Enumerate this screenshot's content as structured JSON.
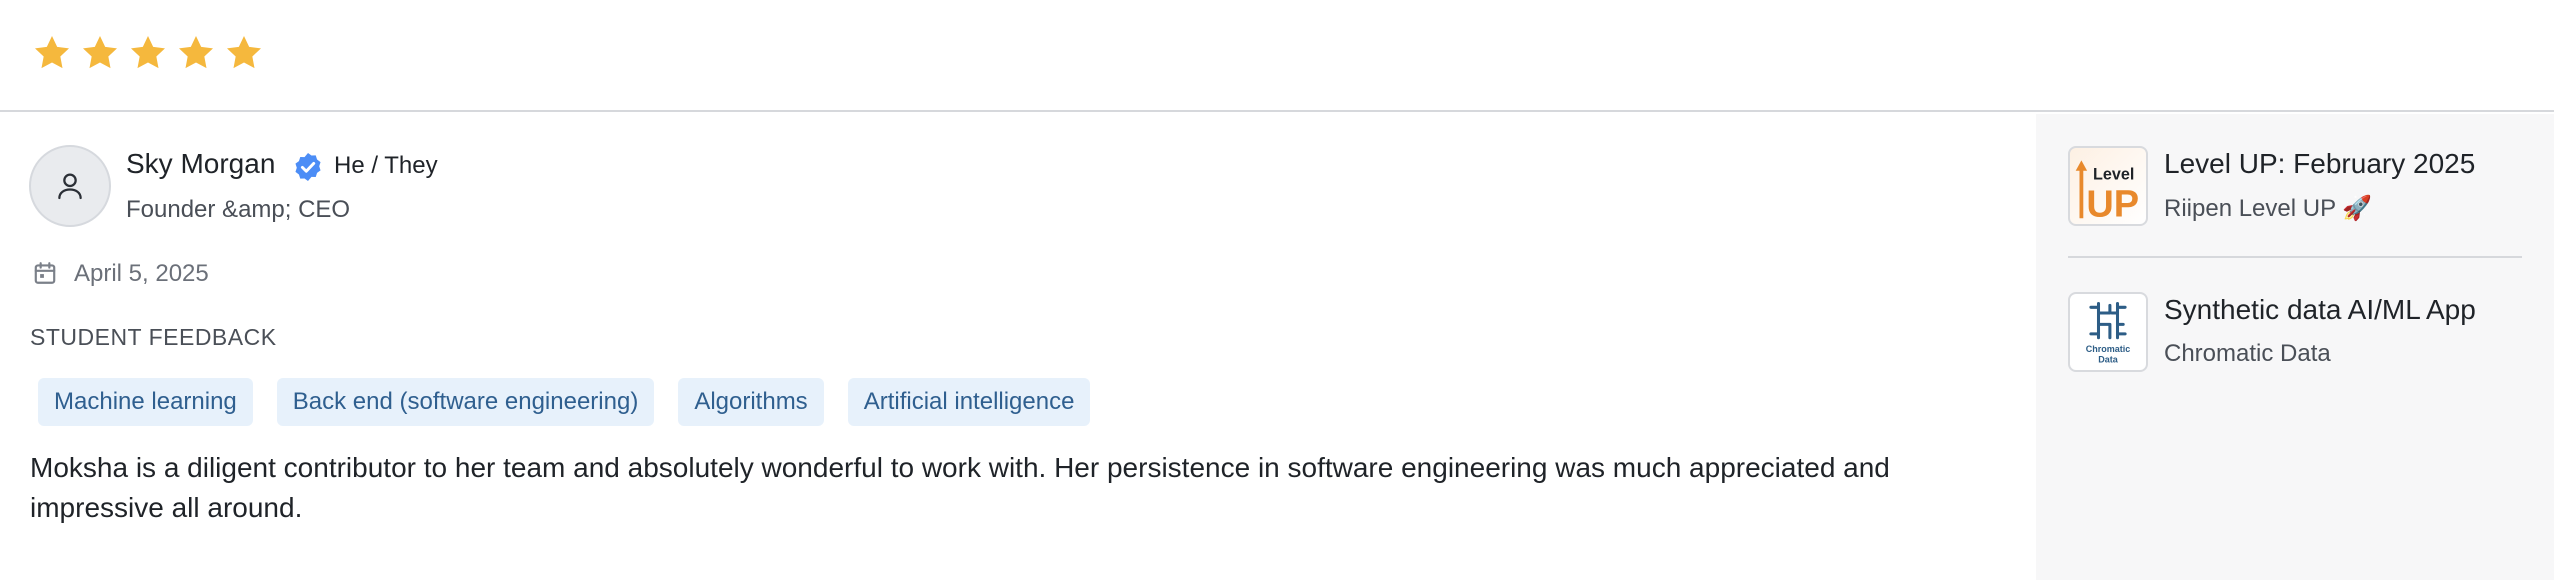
{
  "rating": {
    "value": 5,
    "max": 5,
    "color": "#f5b83d"
  },
  "reviewer": {
    "name": "Sky Morgan",
    "pronouns": "He / They",
    "role": "Founder &amp; CEO",
    "verified_color": "#4c8df6"
  },
  "date": "April 5, 2025",
  "section_label": "STUDENT FEEDBACK",
  "tags": [
    "Machine learning",
    "Back end (software engineering)",
    "Algorithms",
    "Artificial intelligence"
  ],
  "feedback": "Moksha is a diligent contributor to her team and absolutely wonderful to work with. Her persistence in software engineering was much appreciated and impressive all around.",
  "projects": [
    {
      "title": "Level UP: February 2025",
      "org": "Riipen Level UP 🚀",
      "logo_text": [
        "Level",
        "UP"
      ]
    },
    {
      "title": "Synthetic data AI/ML App",
      "org": "Chromatic Data",
      "logo_text": [
        "Chromatic",
        "Data"
      ]
    }
  ],
  "colors": {
    "tag_bg": "#e7f1fb",
    "tag_text": "#2f5f8f",
    "sidebar_bg": "#f7f7f8"
  }
}
